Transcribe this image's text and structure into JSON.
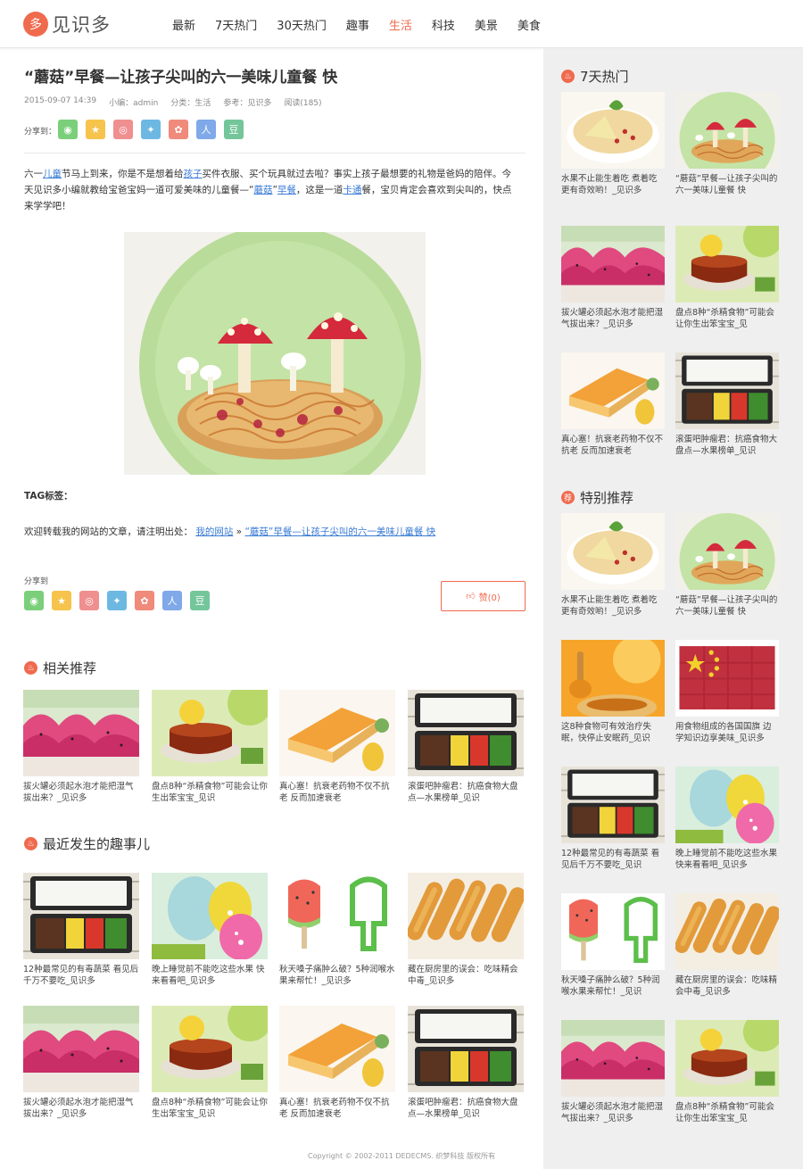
{
  "brand": {
    "logo_glyph": "多",
    "name": "见识多",
    "accent": "#f06a4e"
  },
  "nav": [
    "最新",
    "7天热门",
    "30天热门",
    "趣事",
    "生活",
    "科技",
    "美景",
    "美食"
  ],
  "nav_active_index": 4,
  "article": {
    "title": "“蘑菇”早餐—让孩子尖叫的六一美味儿童餐 快",
    "meta": [
      "2015-09-07 14:39",
      "小编：admin",
      "分类：生活",
      "参考：见识多",
      "阅读(185)"
    ],
    "share_label": "分享到：",
    "share_label2": "分享到",
    "share_icons": [
      {
        "name": "wechat",
        "glyph": "◉",
        "color": "#7bcf7a"
      },
      {
        "name": "favorite",
        "glyph": "★",
        "color": "#f6c34d"
      },
      {
        "name": "weibo",
        "glyph": "◎",
        "color": "#f08f8f"
      },
      {
        "name": "tencent-weibo",
        "glyph": "✦",
        "color": "#6db8e2"
      },
      {
        "name": "qzone",
        "glyph": "✿",
        "color": "#f08a7a"
      },
      {
        "name": "renren",
        "glyph": "人",
        "color": "#7fa9e8"
      },
      {
        "name": "douban",
        "glyph": "豆",
        "color": "#74c69a"
      }
    ],
    "p1": "六一",
    "l1": "儿童",
    "p2": "节马上到来，你是不是想着给",
    "l2": "孩子",
    "p3": "买件衣服、买个玩具就过去啦？事实上孩子最想要的礼物是爸妈的陪伴。今天见识多小编就教给宝爸宝妈一道可爱美味的儿童餐—“",
    "l3": "蘑菇",
    "p4": "”",
    "l4": "早餐",
    "p5": "，这是一道",
    "l5": "卡通",
    "p6": "餐，宝贝肯定会喜欢到尖叫的，快点来学学吧！",
    "tag_label": "TAG标签：",
    "repost_prefix": "欢迎转载我的网站的文章，请注明出处：",
    "repost_site": "我的网站",
    "repost_sep": " » ",
    "repost_title": "“蘑菇”早餐—让孩子尖叫的六一美味儿童餐 快",
    "like_label": "赞(0)"
  },
  "related": {
    "title": "相关推荐",
    "items": [
      {
        "caption": "拔火罐必须起水泡才能把湿气拔出来？_见识多",
        "img": "dragonfruit"
      },
      {
        "caption": "盘点8种“杀精食物”可能会让你生出笨宝宝_见识",
        "img": "tea"
      },
      {
        "caption": "真心塞！抗衰老药物不仅不抗老 反而加速衰老",
        "img": "cake"
      },
      {
        "caption": "滚蛋吧肿瘤君：抗癌食物大盘点—水果榜单_见识",
        "img": "bento"
      }
    ]
  },
  "recent": {
    "title": "最近发生的趣事儿",
    "items": [
      {
        "caption": "12种最常见的有毒蔬菜 看见后千万不要吃_见识多",
        "img": "bento"
      },
      {
        "caption": "晚上睡觉前不能吃这些水果 快来看看吧_见识多",
        "img": "eggs"
      },
      {
        "caption": "秋天嗓子痛肿么破？5种润喉水果来帮忙！_见识多",
        "img": "popsicle"
      },
      {
        "caption": "藏在厨房里的误会：吃味精会中毒_见识多",
        "img": "fried"
      },
      {
        "caption": "拔火罐必须起水泡才能把湿气拔出来？_见识多",
        "img": "dragonfruit"
      },
      {
        "caption": "盘点8种“杀精食物”可能会让你生出笨宝宝_见识",
        "img": "tea"
      },
      {
        "caption": "真心塞！抗衰老药物不仅不抗老 反而加速衰老",
        "img": "cake"
      },
      {
        "caption": "滚蛋吧肿瘤君：抗癌食物大盘点—水果榜单_见识",
        "img": "bento"
      }
    ]
  },
  "sidebar_hot": {
    "title": "7天热门",
    "items": [
      {
        "caption": "水果不止能生着吃 煮着吃更有奇效哟！_见识多",
        "img": "soup"
      },
      {
        "caption": "“蘑菇”早餐—让孩子尖叫的六一美味儿童餐 快",
        "img": "mushroom"
      },
      {
        "caption": "拔火罐必须起水泡才能把湿气拔出来？_见识多",
        "img": "dragonfruit"
      },
      {
        "caption": "盘点8种“杀精食物”可能会让你生出笨宝宝_见",
        "img": "tea"
      },
      {
        "caption": "真心塞！抗衰老药物不仅不抗老 反而加速衰老",
        "img": "cake"
      },
      {
        "caption": "滚蛋吧肿瘤君：抗癌食物大盘点—水果榜单_见识",
        "img": "bento"
      }
    ]
  },
  "sidebar_rec": {
    "title": "特别推荐",
    "items": [
      {
        "caption": "水果不止能生着吃 煮着吃更有奇效哟！_见识多",
        "img": "soup"
      },
      {
        "caption": "“蘑菇”早餐—让孩子尖叫的六一美味儿童餐 快",
        "img": "mushroom"
      },
      {
        "caption": "这8种食物可有效治疗失眠，快停止安眠药_见识",
        "img": "honey"
      },
      {
        "caption": "用食物组成的各国国旗 边学知识边享美味_见识多",
        "img": "flag"
      },
      {
        "caption": "12种最常见的有毒蔬菜 看见后千万不要吃_见识",
        "img": "bento"
      },
      {
        "caption": "晚上睡觉前不能吃这些水果 快来看看吧_见识多",
        "img": "eggs"
      },
      {
        "caption": "秋天嗓子痛肿么破？5种润喉水果来帮忙！_见识",
        "img": "popsicle"
      },
      {
        "caption": "藏在厨房里的误会：吃味精会中毒_见识多",
        "img": "fried"
      },
      {
        "caption": "拔火罐必须起水泡才能把湿气拔出来？_见识多",
        "img": "dragonfruit"
      },
      {
        "caption": "盘点8种“杀精食物”可能会让你生出笨宝宝_见",
        "img": "tea"
      }
    ]
  },
  "footer": "Copyright © 2002-2011 DEDECMS. 织梦科技 版权所有"
}
